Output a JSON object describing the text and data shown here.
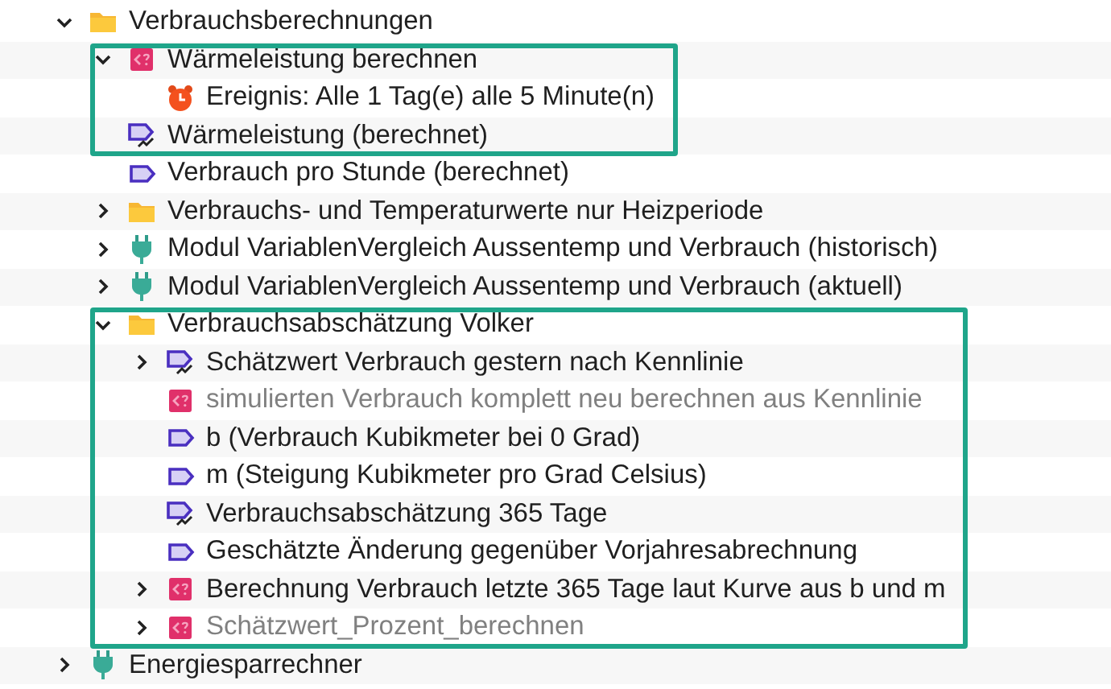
{
  "tree": [
    {
      "label": "Verbrauchsberechnungen",
      "kind": "folder",
      "expanded": true,
      "children": [
        {
          "label": "Wärmeleistung berechnen",
          "kind": "script",
          "expanded": true,
          "highlighted": true,
          "children": [
            {
              "label": "Ereignis: Alle 1 Tag(e) alle 5 Minute(n)",
              "kind": "event"
            }
          ]
        },
        {
          "label": "Wärmeleistung (berechnet)",
          "kind": "computed-variable",
          "highlighted": true
        },
        {
          "label": "Verbrauch pro Stunde (berechnet)",
          "kind": "variable"
        },
        {
          "label": "Verbrauchs- und Temperaturwerte nur Heizperiode",
          "kind": "folder",
          "expanded": false
        },
        {
          "label": "Modul VariablenVergleich Aussentemp und Verbrauch (historisch)",
          "kind": "module",
          "expanded": false
        },
        {
          "label": "Modul VariablenVergleich Aussentemp und Verbrauch (aktuell)",
          "kind": "module",
          "expanded": false
        },
        {
          "label": "Verbrauchsabschätzung Volker",
          "kind": "folder",
          "expanded": true,
          "highlighted": true,
          "children": [
            {
              "label": "Schätzwert Verbrauch gestern nach Kennlinie",
              "kind": "computed-variable",
              "expanded": false
            },
            {
              "label": "simulierten Verbrauch komplett neu berechnen aus Kennlinie",
              "kind": "script",
              "disabled": true
            },
            {
              "label": "b (Verbrauch Kubikmeter bei 0 Grad)",
              "kind": "variable"
            },
            {
              "label": "m (Steigung Kubikmeter pro Grad Celsius)",
              "kind": "variable"
            },
            {
              "label": "Verbrauchsabschätzung 365 Tage",
              "kind": "computed-variable"
            },
            {
              "label": "Geschätzte Änderung gegenüber Vorjahresabrechnung",
              "kind": "variable"
            },
            {
              "label": "Berechnung Verbrauch letzte 365 Tage laut Kurve aus b und m",
              "kind": "script",
              "expanded": false
            },
            {
              "label": "Schätzwert_Prozent_berechnen",
              "kind": "script",
              "expanded": false,
              "disabled": true
            }
          ]
        }
      ]
    },
    {
      "label": "Energiesparrechner",
      "kind": "module",
      "expanded": false
    }
  ]
}
